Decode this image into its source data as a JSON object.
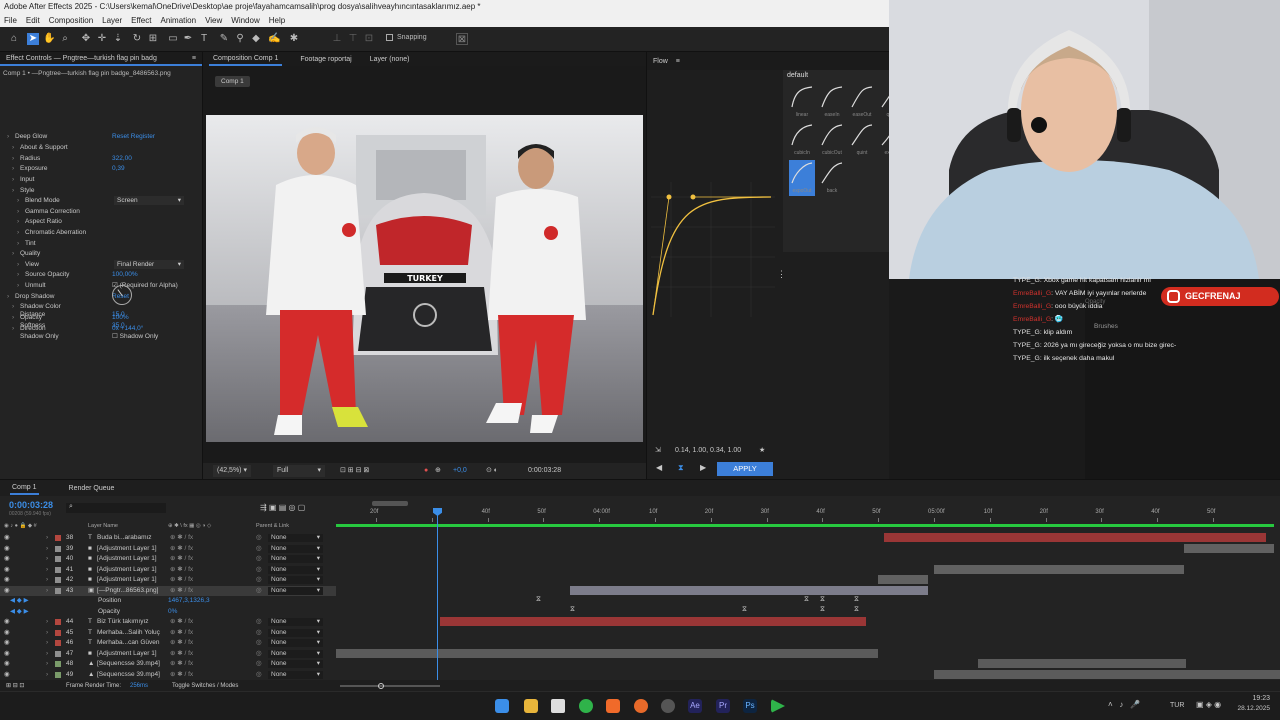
{
  "window": {
    "title": "Adobe After Effects 2025 - C:\\Users\\kemal\\OneDrive\\Desktop\\ae proje\\fayahamcamsalih\\prog dosya\\salihveayhıncıntasaklarımız.aep *"
  },
  "menu": [
    "File",
    "Edit",
    "Composition",
    "Layer",
    "Effect",
    "Animation",
    "View",
    "Window",
    "Help"
  ],
  "toolbar": {
    "snapping_label": "Snapping"
  },
  "effect_controls": {
    "tab_label": "Effect Controls — Pngtree—turkish flag pin badg",
    "subtitle": "Comp 1 • —Pngtree—turkish flag pin badge_8486563.png",
    "rows": [
      {
        "label": "Deep Glow",
        "value": "Reset   Register",
        "indent": 1,
        "blue": true
      },
      {
        "label": "About & Support",
        "value": "",
        "indent": 2
      },
      {
        "label": "Radius",
        "value": "322,00",
        "indent": 2,
        "blue": true
      },
      {
        "label": "Exposure",
        "value": "0,39",
        "indent": 2,
        "blue": true
      },
      {
        "label": "Input",
        "value": "",
        "indent": 2
      },
      {
        "label": "Style",
        "value": "",
        "indent": 2
      },
      {
        "label": "Blend Mode",
        "value": "",
        "indent": 3,
        "select": "Screen"
      },
      {
        "label": "Gamma Correction",
        "value": "",
        "indent": 3
      },
      {
        "label": "Aspect Ratio",
        "value": "",
        "indent": 3
      },
      {
        "label": "Chromatic Aberration",
        "value": "",
        "indent": 3
      },
      {
        "label": "Tint",
        "value": "",
        "indent": 3
      },
      {
        "label": "Quality",
        "value": "",
        "indent": 2
      },
      {
        "label": "View",
        "value": "",
        "indent": 3,
        "select": "Final Render"
      },
      {
        "label": "Source Opacity",
        "value": "100,00%",
        "indent": 3,
        "blue": true
      },
      {
        "label": "Unmult",
        "value": "☑ (Required for Alpha)",
        "indent": 3
      },
      {
        "label": "Drop Shadow",
        "value": "Reset",
        "indent": 1,
        "blue": true
      },
      {
        "label": "Shadow Color",
        "value": "",
        "indent": 2
      },
      {
        "label": "Opacity",
        "value": "100%",
        "indent": 2,
        "blue": true
      },
      {
        "label": "Direction",
        "value": "0x +144,0°",
        "indent": 2,
        "blue": true
      }
    ],
    "rows2": [
      {
        "label": "Distance",
        "value": "15,0"
      },
      {
        "label": "Softness",
        "value": "35,0"
      },
      {
        "label": "Shadow Only",
        "value": "☐ Shadow Only"
      }
    ]
  },
  "composition": {
    "tabs": [
      "Composition Comp 1",
      "Footage roportaj",
      "Layer (none)"
    ],
    "comp_chip": "Comp 1",
    "scene_text": "TURKEY",
    "zoom": "(42,5%)",
    "resolution": "Full",
    "exposure": "+0,0",
    "timecode": "0:00:03:28"
  },
  "flow": {
    "title": "Flow",
    "preset_group": "default",
    "preset_labels": [
      "linear",
      "easeIn",
      "easeOut",
      "quad",
      "cubicIn",
      "cubicOut",
      "quint",
      "expoIn",
      "expoOut",
      "back"
    ],
    "bezier_values": "0.14, 1.00, 0.34, 1.00",
    "apply_label": "APPLY"
  },
  "stream": {
    "chat": [
      {
        "user": "TYPE_G",
        "text": ": Xbox game hit kapatsam hizlanir mi",
        "red": false
      },
      {
        "user": "EmreBalli_G",
        "text": ": VAY ABİM iyi yayınlar nerlerde",
        "red": true
      },
      {
        "user": "EmreBalli_G",
        "text": ": ooo büyük iddia",
        "red": true
      },
      {
        "user": "EmreBalli_G",
        "text": ": 🥶",
        "red": true
      },
      {
        "user": "TYPE_G",
        "text": ": klip aldım",
        "red": false
      },
      {
        "user": "TYPE_G",
        "text": ": 2026 ya mı gireceğiz yoksa o mu bize girec-",
        "red": false
      },
      {
        "user": "TYPE_G",
        "text": ": ilk seçenek daha makul",
        "red": false
      }
    ],
    "instagram_handle": "GECFRENAJ",
    "panel_labels": [
      "Opacity",
      "Brushes"
    ]
  },
  "timeline": {
    "tabs": [
      "Comp 1",
      "Render Queue"
    ],
    "timecode": "0:00:03:28",
    "timecode_sub": "00208 (59.940 fps)",
    "headers": {
      "layer_name": "Layer Name",
      "parent": "Parent & Link"
    },
    "ruler": [
      "20f",
      "",
      "40f",
      "50f",
      "04:00f",
      "10f",
      "20f",
      "30f",
      "40f",
      "50f",
      "05:00f",
      "10f",
      "20f",
      "30f",
      "40f",
      "50f"
    ],
    "layers": [
      {
        "num": "38",
        "icon": "T",
        "name": "Buda bi...arabamız",
        "parent": "None",
        "color": "#b3473f"
      },
      {
        "num": "39",
        "icon": "■",
        "name": "[Adjustment Layer 1]",
        "parent": "None",
        "color": "#8f8f8f"
      },
      {
        "num": "40",
        "icon": "■",
        "name": "[Adjustment Layer 1]",
        "parent": "None",
        "color": "#8f8f8f"
      },
      {
        "num": "41",
        "icon": "■",
        "name": "[Adjustment Layer 1]",
        "parent": "None",
        "color": "#8f8f8f"
      },
      {
        "num": "42",
        "icon": "■",
        "name": "[Adjustment Layer 1]",
        "parent": "None",
        "color": "#8f8f8f"
      },
      {
        "num": "43",
        "icon": "▣",
        "name": "[—Pngtr...86563.png]",
        "parent": "None",
        "color": "#8f8f8f",
        "selected": true
      }
    ],
    "props": [
      {
        "name": "Position",
        "value": "1467,3,1326,3"
      },
      {
        "name": "Opacity",
        "value": "0%"
      }
    ],
    "layers2": [
      {
        "num": "44",
        "icon": "T",
        "name": "Biz Türk takımıyız",
        "parent": "None",
        "color": "#b3473f"
      },
      {
        "num": "45",
        "icon": "T",
        "name": "Merhaba...Salih Yoluç",
        "parent": "None",
        "color": "#b3473f"
      },
      {
        "num": "46",
        "icon": "T",
        "name": "Merhaba...can Güven",
        "parent": "None",
        "color": "#b3473f"
      },
      {
        "num": "47",
        "icon": "■",
        "name": "[Adjustment Layer 1]",
        "parent": "None",
        "color": "#8f8f8f"
      },
      {
        "num": "48",
        "icon": "▲",
        "name": "[Sequencsse 39.mp4]",
        "parent": "None",
        "color": "#7a9b6a"
      },
      {
        "num": "49",
        "icon": "▲",
        "name": "[Sequencsse 39.mp4]",
        "parent": "None",
        "color": "#7a9b6a"
      }
    ],
    "footer": {
      "render_time_label": "Frame Render Time:",
      "render_time": "256ms",
      "toggle": "Toggle Switches / Modes"
    }
  },
  "taskbar": {
    "lang": "TUR",
    "time": "19:23",
    "date": "28.12.2025"
  }
}
